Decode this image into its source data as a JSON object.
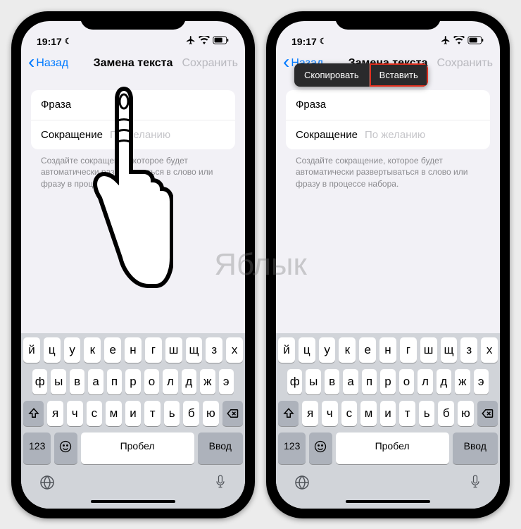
{
  "watermark": "Яблык",
  "status": {
    "time": "19:17",
    "airplane_glyph": "✈",
    "wifi_glyph": "ᯤ",
    "battery_glyph": "▢"
  },
  "nav": {
    "back": "Назад",
    "title": "Замена текста",
    "save": "Сохранить"
  },
  "fields": {
    "phrase_label": "Фраза",
    "shortcut_label": "Сокращение",
    "shortcut_placeholder": "По желанию"
  },
  "hint": "Создайте сокращение, которое будет автоматически развертываться в слово или фразу в процессе набора.",
  "context_menu": {
    "copy": "Скопировать",
    "paste": "Вставить"
  },
  "keyboard": {
    "row1": [
      "й",
      "ц",
      "у",
      "к",
      "е",
      "н",
      "г",
      "ш",
      "щ",
      "з",
      "х"
    ],
    "row2": [
      "ф",
      "ы",
      "в",
      "а",
      "п",
      "р",
      "о",
      "л",
      "д",
      "ж",
      "э"
    ],
    "row3": [
      "я",
      "ч",
      "с",
      "м",
      "и",
      "т",
      "ь",
      "б",
      "ю"
    ],
    "numbers": "123",
    "emoji": "☺",
    "space": "Пробел",
    "enter": "Ввод",
    "globe": "🌐",
    "mic": "🎤"
  }
}
